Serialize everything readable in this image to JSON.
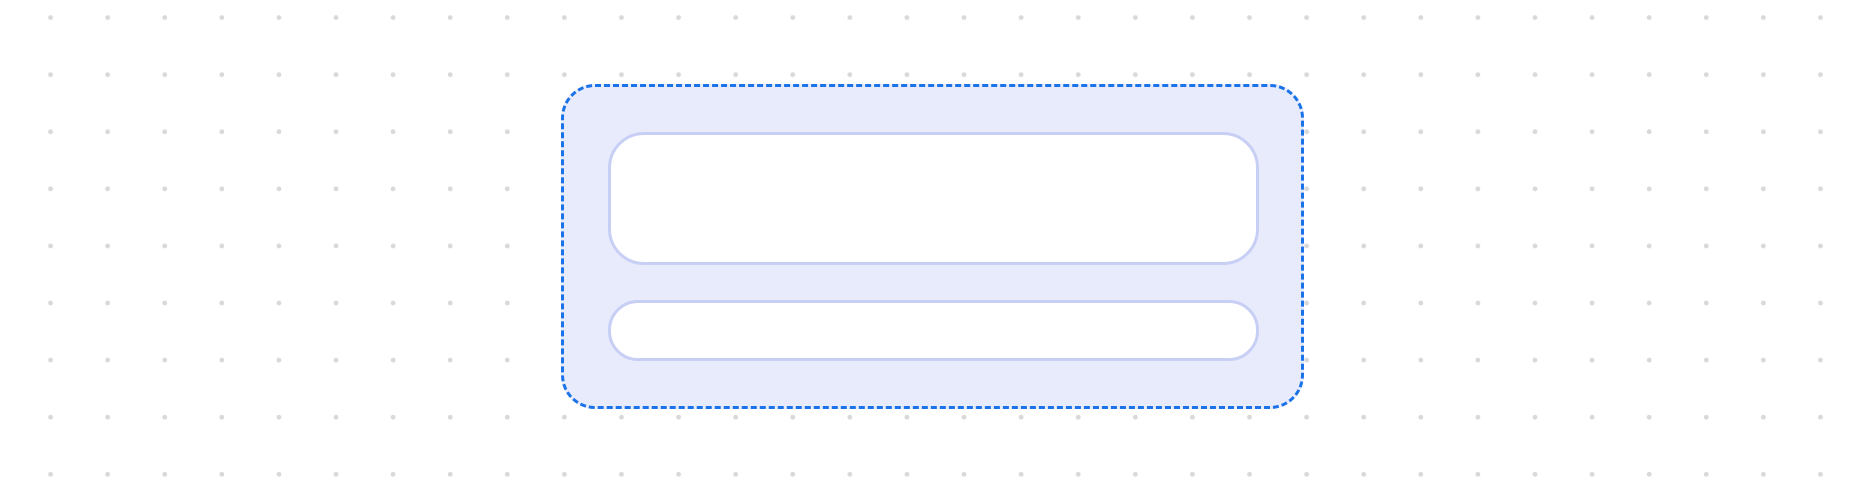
{
  "canvas": {
    "background": "dotted-grid",
    "dot_color": "#d9d9d9"
  },
  "selection_group": {
    "border_style": "dashed",
    "border_color": "#1a73e8",
    "fill_color": "#e8ebfc",
    "blocks": [
      {
        "name": "large-block",
        "text": ""
      },
      {
        "name": "small-block",
        "text": ""
      }
    ]
  }
}
